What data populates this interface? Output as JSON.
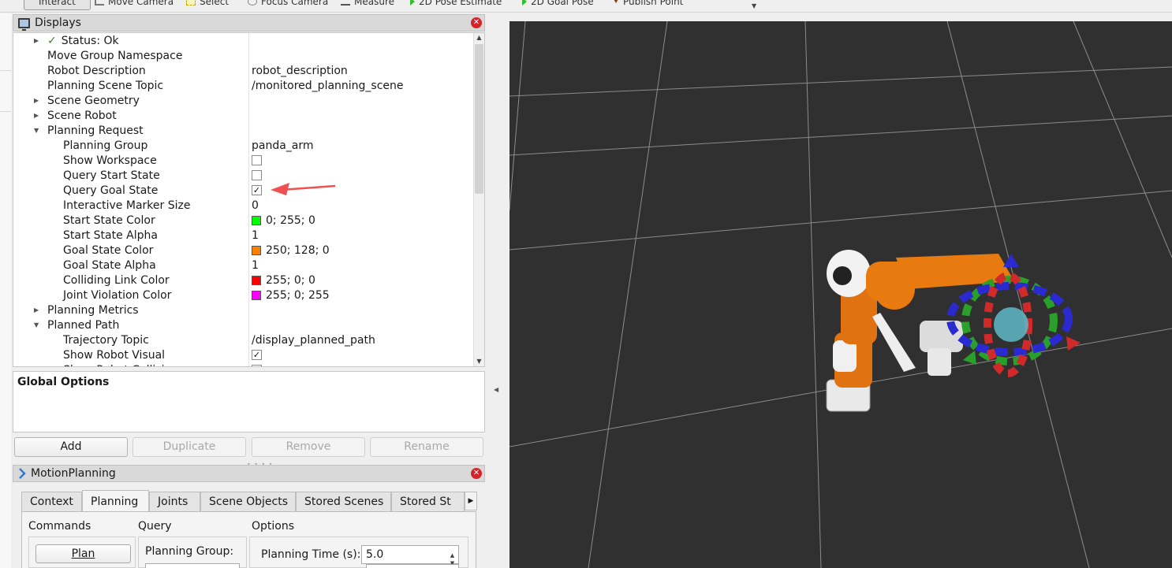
{
  "toolbar": {
    "items": [
      {
        "label": "Interact",
        "icon": "interact-icon"
      },
      {
        "label": "Move Camera",
        "icon": "move-camera-icon"
      },
      {
        "label": "Select",
        "icon": "select-icon"
      },
      {
        "label": "Focus Camera",
        "icon": "focus-camera-icon"
      },
      {
        "label": "Measure",
        "icon": "measure-icon"
      },
      {
        "label": "2D Pose Estimate",
        "icon": "pose-estimate-icon"
      },
      {
        "label": "2D Goal Pose",
        "icon": "goal-pose-icon"
      },
      {
        "label": "Publish Point",
        "icon": "publish-point-icon"
      }
    ]
  },
  "displays": {
    "title": "Displays",
    "rows": [
      {
        "name": "Status: Ok",
        "value": "",
        "expander": "collapsed",
        "status_check": true
      },
      {
        "name": "Move Group Namespace",
        "value": ""
      },
      {
        "name": "Robot Description",
        "value": "robot_description"
      },
      {
        "name": "Planning Scene Topic",
        "value": "/monitored_planning_scene"
      },
      {
        "name": "Scene Geometry",
        "value": "",
        "expander": "collapsed"
      },
      {
        "name": "Scene Robot",
        "value": "",
        "expander": "collapsed"
      },
      {
        "name": "Planning Request",
        "value": "",
        "expander": "expanded"
      },
      {
        "name": "Planning Group",
        "value": "panda_arm",
        "child": true
      },
      {
        "name": "Show Workspace",
        "checkbox": false,
        "child": true
      },
      {
        "name": "Query Start State",
        "checkbox": false,
        "child": true
      },
      {
        "name": "Query Goal State",
        "checkbox": true,
        "child": true
      },
      {
        "name": "Interactive Marker Size",
        "value": "0",
        "child": true
      },
      {
        "name": "Start State Color",
        "value": "0; 255; 0",
        "swatch": "#00ff00",
        "child": true
      },
      {
        "name": "Start State Alpha",
        "value": "1",
        "child": true
      },
      {
        "name": "Goal State Color",
        "value": "250; 128; 0",
        "swatch": "#fa8000",
        "child": true
      },
      {
        "name": "Goal State Alpha",
        "value": "1",
        "child": true
      },
      {
        "name": "Colliding Link Color",
        "value": "255; 0; 0",
        "swatch": "#ff0000",
        "child": true
      },
      {
        "name": "Joint Violation Color",
        "value": "255; 0; 255",
        "swatch": "#ff00ff",
        "child": true
      },
      {
        "name": "Planning Metrics",
        "value": "",
        "expander": "collapsed"
      },
      {
        "name": "Planned Path",
        "value": "",
        "expander": "expanded"
      },
      {
        "name": "Trajectory Topic",
        "value": "/display_planned_path",
        "child": true
      },
      {
        "name": "Show Robot Visual",
        "checkbox": true,
        "child": true
      },
      {
        "name": "Show Robot Collisi",
        "checkbox": false,
        "child": true
      }
    ]
  },
  "global_options": {
    "title": "Global Options"
  },
  "display_buttons": {
    "add": "Add",
    "duplicate": "Duplicate",
    "remove": "Remove",
    "rename": "Rename"
  },
  "motion_planning": {
    "title": "MotionPlanning",
    "tabs": [
      "Context",
      "Planning",
      "Joints",
      "Scene Objects",
      "Stored Scenes",
      "Stored St"
    ],
    "active_tab": "Planning",
    "commands_label": "Commands",
    "query_label": "Query",
    "options_label": "Options",
    "plan_button": "Plan",
    "planning_group_label": "Planning Group:",
    "planning_time_label": "Planning Time (s):",
    "planning_time_value": "5.0"
  },
  "colors": {
    "annotation_arrow": "#f05050",
    "viewport_bg": "#303030",
    "robot_orange": "#e87a10"
  }
}
